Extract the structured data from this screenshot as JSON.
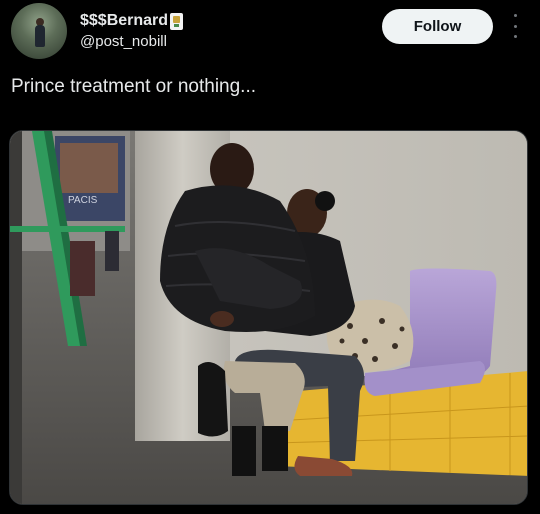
{
  "author": {
    "display_name": "$$$Bernard",
    "handle": "@post_nobill",
    "badge_icon": "emoji-badge-icon"
  },
  "actions": {
    "follow_label": "Follow",
    "more_icon": "more-vertical-icon"
  },
  "tweet": {
    "text": "Prince treatment or nothing..."
  },
  "poster": {
    "text": "PACIS"
  }
}
